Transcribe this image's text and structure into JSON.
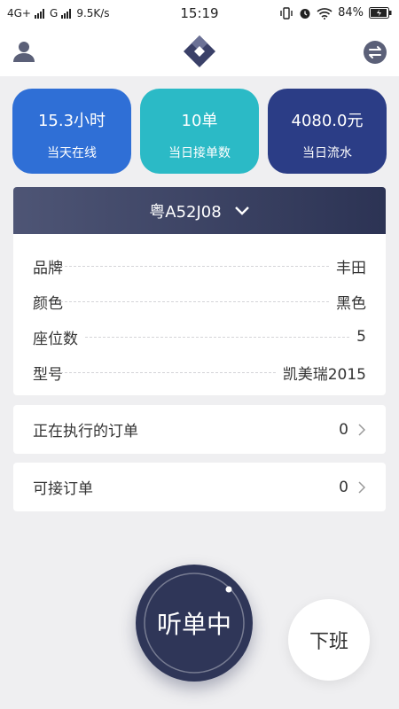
{
  "status_bar": {
    "network": "4G+",
    "network2": "G",
    "speed": "9.5K/s",
    "time": "15:19",
    "battery": "84%"
  },
  "stats": [
    {
      "value": "15.3小时",
      "label": "当天在线",
      "color": "#2f6fd6"
    },
    {
      "value": "10单",
      "label": "当日接单数",
      "color": "#2bbac6"
    },
    {
      "value": "4080.0元",
      "label": "当日流水",
      "color": "#2b3d86"
    }
  ],
  "vehicle": {
    "plate": "粤A52J08",
    "rows": [
      {
        "key": "品牌",
        "value": "丰田"
      },
      {
        "key": "颜色",
        "value": "黑色"
      },
      {
        "key": "座位数",
        "value": "5"
      },
      {
        "key": "型号",
        "value": "凯美瑞2015"
      }
    ]
  },
  "orders": {
    "executing_label": "正在执行的订单",
    "executing_count": "0",
    "available_label": "可接订单",
    "available_count": "0"
  },
  "actions": {
    "listening_label": "听单中",
    "off_work_label": "下班"
  },
  "colors": {
    "accent_dark": "#2f3658",
    "header_gradient_start": "#4e5575",
    "header_gradient_end": "#2c3354"
  }
}
